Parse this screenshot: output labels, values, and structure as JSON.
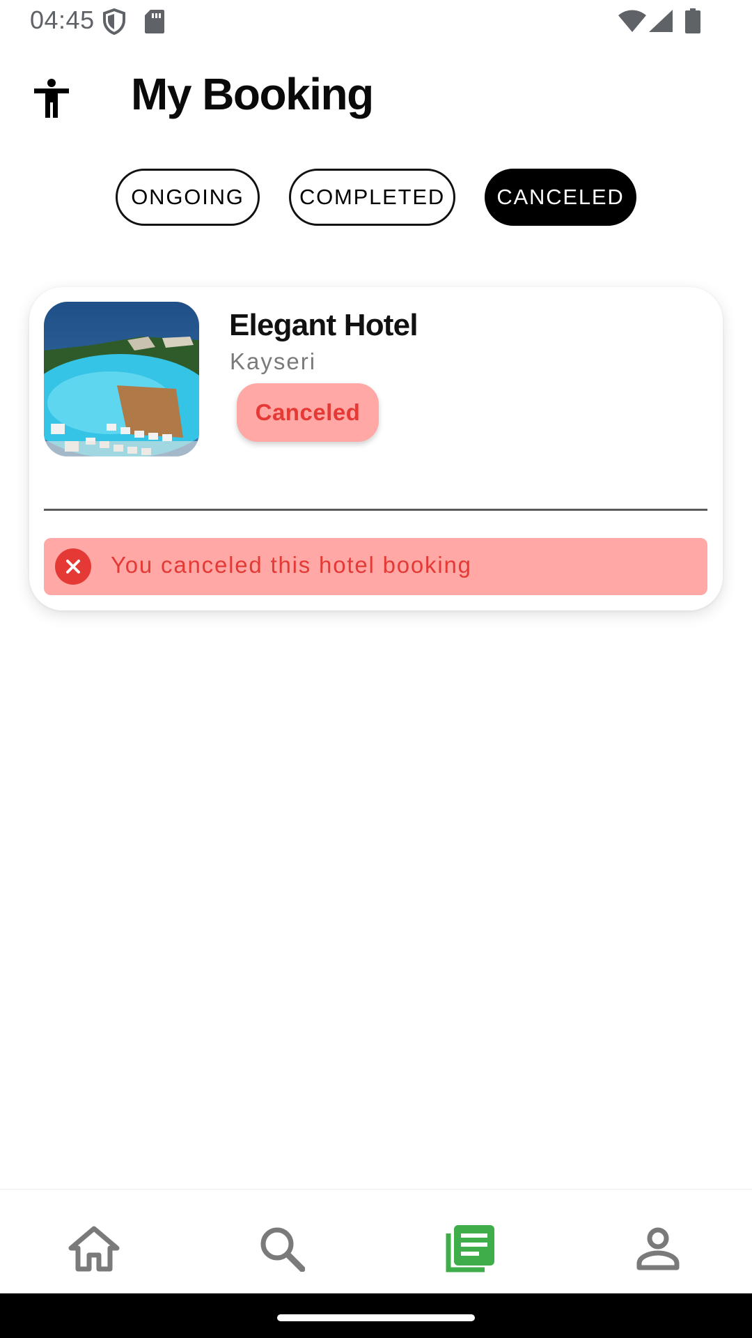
{
  "status_bar": {
    "time": "04:45",
    "left_icons": [
      "shield-icon",
      "sd-card-icon"
    ],
    "right_icons": [
      "wifi-icon",
      "cell-signal-icon",
      "battery-icon"
    ]
  },
  "header": {
    "title": "My Booking",
    "left_icon": "accessibility-icon"
  },
  "tabs": [
    {
      "label": "ONGOING",
      "active": false
    },
    {
      "label": "COMPLETED",
      "active": false
    },
    {
      "label": "CANCELED",
      "active": true
    }
  ],
  "bookings": [
    {
      "hotel_name": "Elegant Hotel",
      "city": "Kayseri",
      "status": "Canceled",
      "notice": "You canceled this hotel booking"
    }
  ],
  "bottom_nav": [
    {
      "icon": "home-icon",
      "active": false
    },
    {
      "icon": "search-icon",
      "active": false
    },
    {
      "icon": "bookings-icon",
      "active": true
    },
    {
      "icon": "profile-icon",
      "active": false
    }
  ],
  "colors": {
    "accent_green": "#3fae4a",
    "cancel_red": "#e53935",
    "cancel_bg": "#ffa8a5",
    "inactive_icon": "#7a7a7a"
  }
}
